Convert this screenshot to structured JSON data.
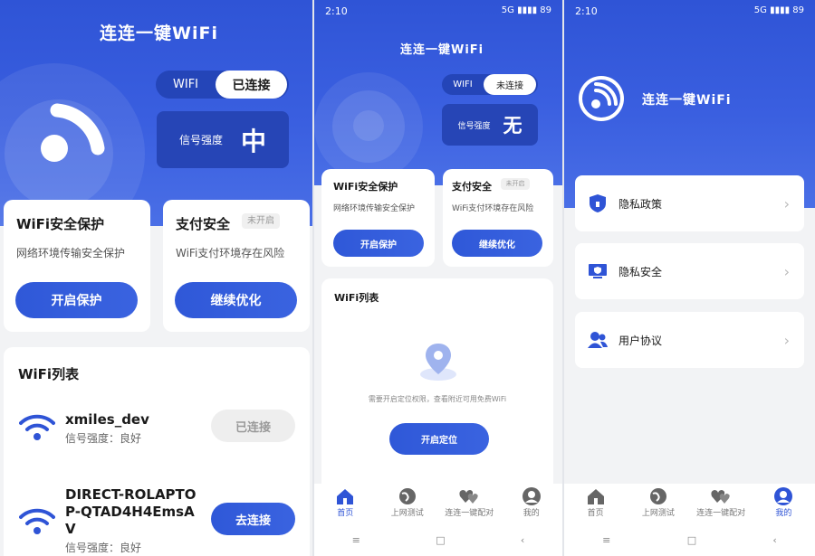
{
  "screen1": {
    "app_title": "连连一键WiFi",
    "toggle": {
      "left": "WIFI",
      "right": "已连接"
    },
    "signal": {
      "label": "信号强度",
      "value": "中"
    },
    "wifi_card": {
      "title": "WiFi安全保护",
      "subtitle": "网络环境传输安全保护",
      "button": "开启保护"
    },
    "pay_card": {
      "title": "支付安全",
      "badge": "未开启",
      "subtitle": "WiFi支付环境存在风险",
      "button": "继续优化"
    },
    "list_title": "WiFi列表",
    "networks": [
      {
        "name": "xmiles_dev",
        "signal": "信号强度：良好",
        "action": "已连接"
      },
      {
        "name_line1": "DIRECT-ROLAPTO",
        "name_line2": "P-QTAD4H4EmsA",
        "name_line3": "V",
        "signal": "信号强度：良好",
        "action": "去连接"
      }
    ]
  },
  "screen2": {
    "status_time": "2:10",
    "status_right": "5G ▮▮▮▮ 89",
    "app_title": "连连一键WiFi",
    "toggle": {
      "left": "WIFI",
      "right": "未连接"
    },
    "signal": {
      "label": "信号强度",
      "value": "无"
    },
    "wifi_card": {
      "title": "WiFi安全保护",
      "subtitle": "网络环境传输安全保护",
      "button": "开启保护"
    },
    "pay_card": {
      "title": "支付安全",
      "badge": "未开启",
      "subtitle": "WiFi支付环境存在风险",
      "button": "继续优化"
    },
    "list_title": "WiFi列表",
    "location_hint": "需要开启定位权限，查看附近可用免费WiFi",
    "location_button": "开启定位",
    "tabs": [
      "首页",
      "上网测试",
      "连连一键配对",
      "我的"
    ]
  },
  "screen3": {
    "status_time": "2:10",
    "status_right": "5G ▮▮▮▮ 89",
    "app_name": "连连一键WiFi",
    "menu": [
      "隐私政策",
      "隐私安全",
      "用户协议"
    ],
    "tabs": [
      "首页",
      "上网测试",
      "连连一键配对",
      "我的"
    ]
  },
  "nav": {
    "menu": "≡",
    "home": "□",
    "back": "‹"
  },
  "colors": {
    "primary": "#2f54d6",
    "hero_dark": "#2645b6",
    "background": "#f2f3f5"
  }
}
